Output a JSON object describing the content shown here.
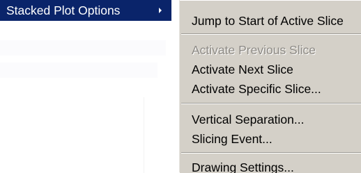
{
  "parent_menu": {
    "active_item_label": "Stacked Plot Options"
  },
  "submenu": {
    "items": [
      {
        "label": "Jump to Start of Active Slice",
        "enabled": true
      },
      {
        "label": "Activate Previous Slice",
        "enabled": false
      },
      {
        "label": "Activate Next Slice",
        "enabled": true
      },
      {
        "label": "Activate Specific Slice...",
        "enabled": true
      },
      {
        "label": "Vertical Separation...",
        "enabled": true
      },
      {
        "label": "Slicing Event...",
        "enabled": true
      },
      {
        "label": "Drawing Settings...",
        "enabled": true
      }
    ]
  },
  "colors": {
    "highlight": "#0a246a",
    "menu_face": "#d4d0c8",
    "disabled_text": "#8d8a85"
  }
}
